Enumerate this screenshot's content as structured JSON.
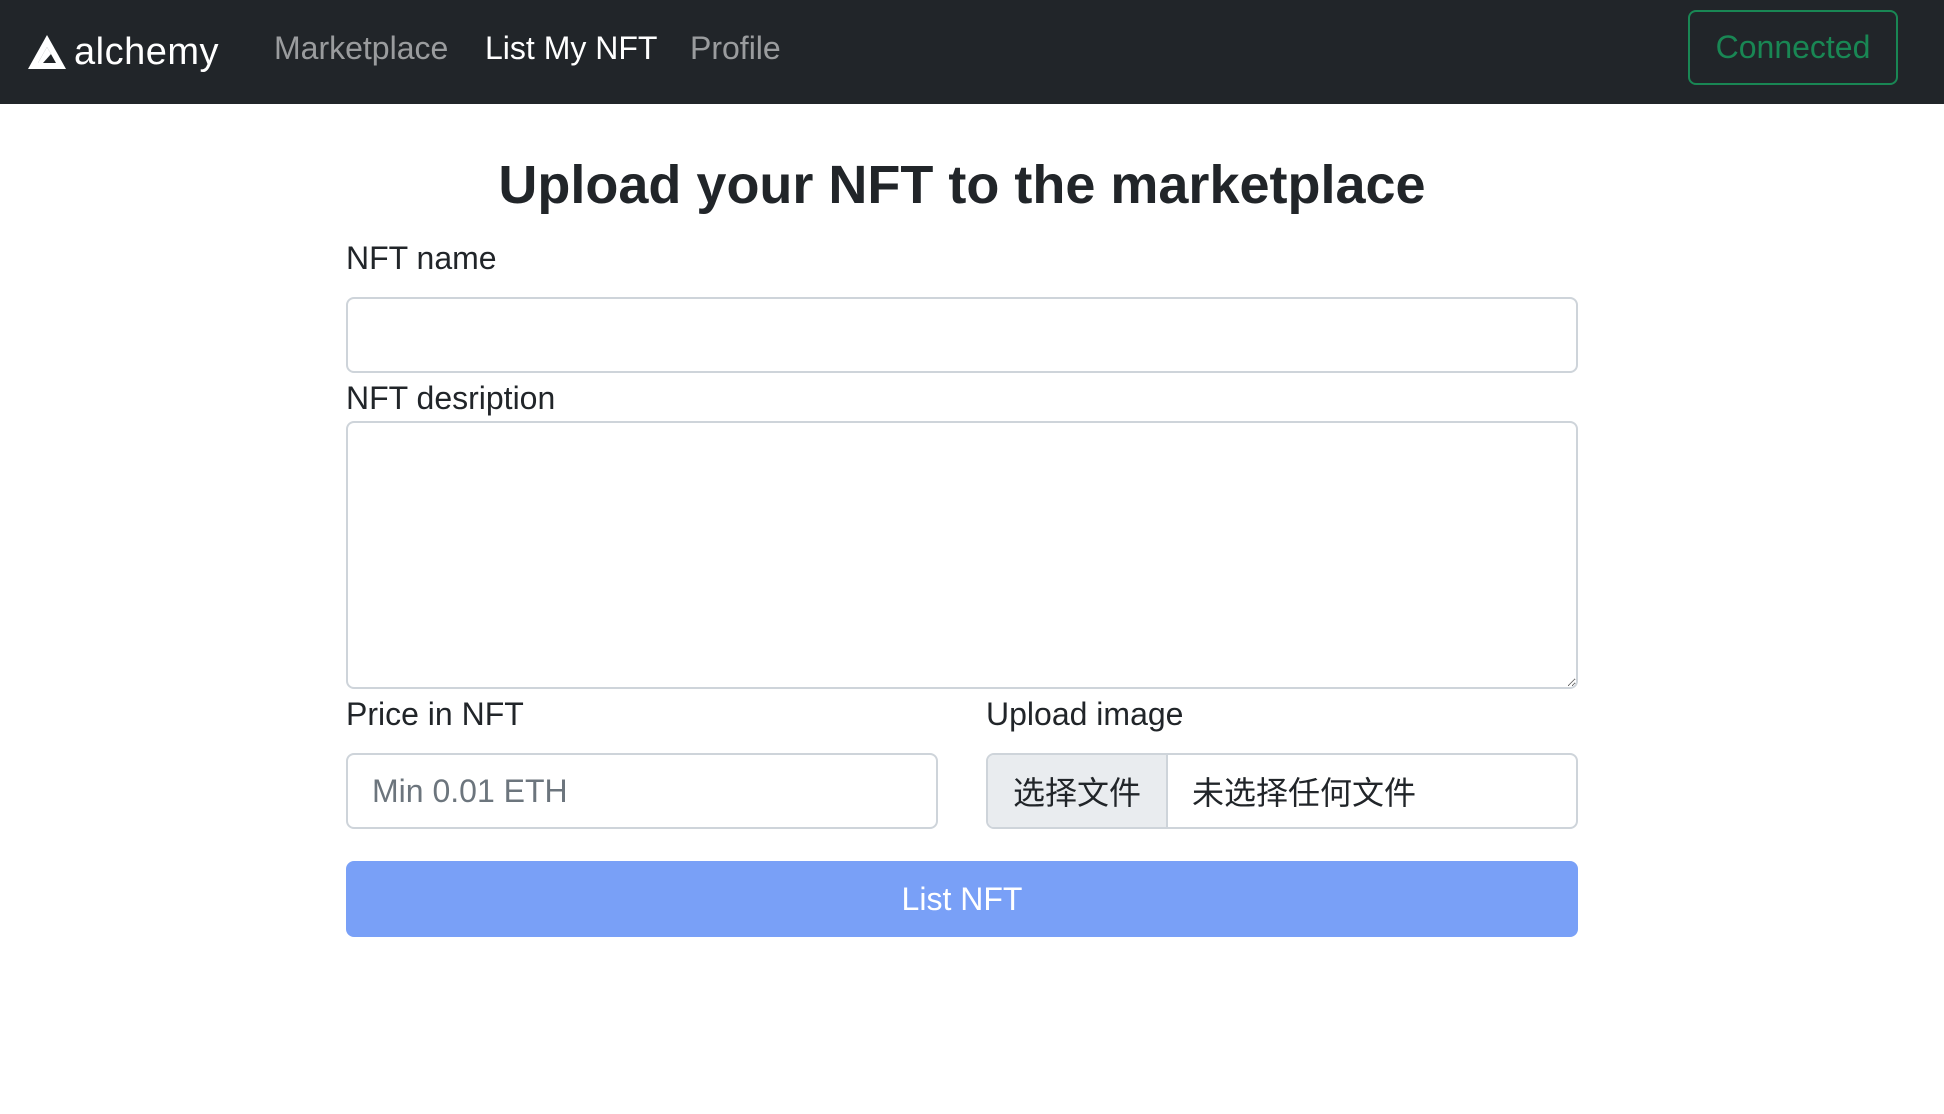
{
  "navbar": {
    "brand": "alchemy",
    "links": [
      {
        "label": "Marketplace",
        "active": false
      },
      {
        "label": "List My NFT",
        "active": true
      },
      {
        "label": "Profile",
        "active": false
      }
    ],
    "connect_label": "Connected"
  },
  "form": {
    "title": "Upload your NFT to the marketplace",
    "name": {
      "label": "NFT name",
      "value": "",
      "placeholder": ""
    },
    "description": {
      "label": "NFT desription",
      "value": ""
    },
    "price": {
      "label": "Price in NFT",
      "value": "",
      "placeholder": "Min 0.01 ETH"
    },
    "image": {
      "label": "Upload image",
      "button_label": "选择文件",
      "status": "未选择任何文件"
    },
    "submit_label": "List NFT"
  },
  "colors": {
    "navbar_bg": "#212529",
    "connected_green": "#198754",
    "submit_blue": "#79a0f7",
    "input_border": "#ced4da"
  }
}
